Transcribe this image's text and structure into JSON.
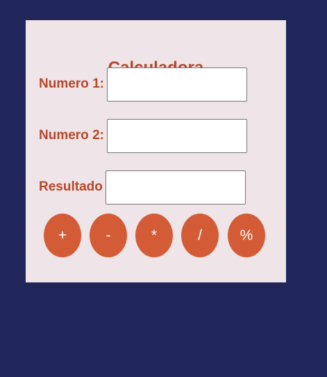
{
  "calculator": {
    "title": "Calculadora",
    "fields": [
      {
        "label": "Numero 1:",
        "value": "",
        "placeholder": ""
      },
      {
        "label": "Numero 2:",
        "value": "",
        "placeholder": ""
      },
      {
        "label": "Resultado",
        "value": "",
        "placeholder": ""
      }
    ],
    "operations": [
      {
        "symbol": "+"
      },
      {
        "symbol": "-"
      },
      {
        "symbol": "*"
      },
      {
        "symbol": "/"
      },
      {
        "symbol": "%"
      }
    ]
  },
  "colors": {
    "page_background": "#21265a",
    "card_background": "#efe4e7",
    "label_text": "#b5472b",
    "button_background": "#d35c37",
    "button_text": "#ffffff"
  }
}
